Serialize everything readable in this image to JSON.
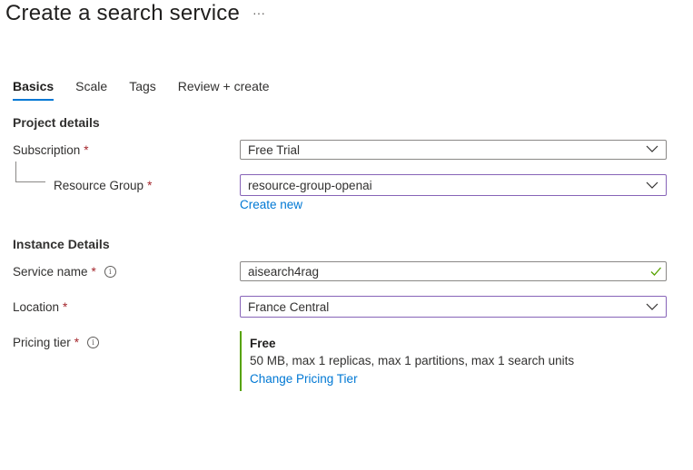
{
  "page": {
    "title": "Create a search service",
    "more_label": "···"
  },
  "tabs": [
    {
      "label": "Basics",
      "active": true
    },
    {
      "label": "Scale",
      "active": false
    },
    {
      "label": "Tags",
      "active": false
    },
    {
      "label": "Review + create",
      "active": false
    }
  ],
  "project_details": {
    "title": "Project details",
    "subscription": {
      "label": "Subscription",
      "required": "*",
      "value": "Free Trial"
    },
    "resource_group": {
      "label": "Resource Group",
      "required": "*",
      "value": "resource-group-openai",
      "create_new": "Create new"
    }
  },
  "instance_details": {
    "title": "Instance Details",
    "service_name": {
      "label": "Service name",
      "required": "*",
      "value": "aisearch4rag"
    },
    "location": {
      "label": "Location",
      "required": "*",
      "value": "France Central"
    },
    "pricing_tier": {
      "label": "Pricing tier",
      "required": "*",
      "name": "Free",
      "description": "50 MB, max 1 replicas, max 1 partitions, max 1 search units",
      "change_link": "Change Pricing Tier"
    }
  },
  "icons": {
    "info": "info-icon",
    "chevron": "chevron-down-icon",
    "valid": "checkmark-icon"
  },
  "colors": {
    "accent": "#0078d4",
    "required": "#a4262c",
    "focus_border": "#8764b8",
    "valid": "#57a300"
  }
}
